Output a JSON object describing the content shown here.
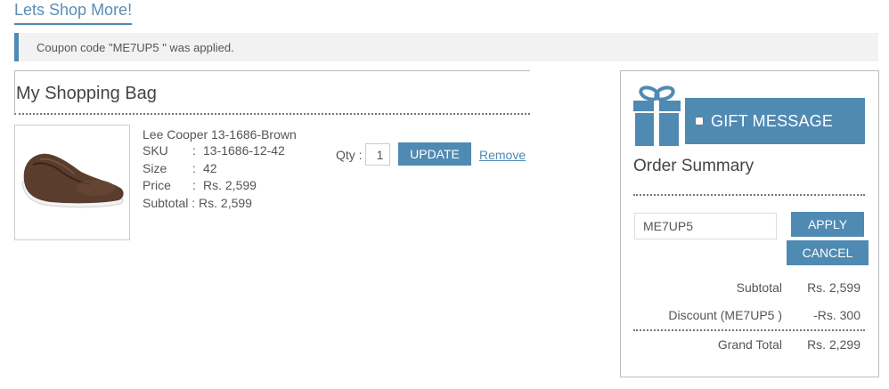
{
  "header": {
    "shop_more_link": "Lets Shop More!"
  },
  "notice": {
    "message": "Coupon code \"ME7UP5 \" was applied."
  },
  "bag": {
    "title": "My Shopping Bag",
    "item": {
      "name": "Lee Cooper 13-1686-Brown",
      "sku_label": "SKU",
      "sku_colon": ":",
      "sku_value": "13-1686-12-42",
      "size_label": "Size",
      "size_colon": ":",
      "size_value": "42",
      "price_label": "Price",
      "price_colon": ":",
      "price_value": "Rs. 2,599",
      "subtotal_text": "Subtotal : Rs. 2,599",
      "qty_label": "Qty :",
      "qty_value": "1",
      "update_label": "UPDATE",
      "remove_label": "Remove"
    }
  },
  "summary": {
    "gift_label": "GIFT MESSAGE",
    "title": "Order Summary",
    "coupon_value": "ME7UP5",
    "apply_label": "APPLY",
    "cancel_label": "CANCEL",
    "subtotal_label": "Subtotal",
    "subtotal_value": "Rs. 2,599",
    "discount_label": "Discount (ME7UP5 )",
    "discount_value": "-Rs. 300",
    "grand_total_label": "Grand Total",
    "grand_total_value": "Rs. 2,299"
  },
  "colors": {
    "accent": "#4f8ab3",
    "link": "#5b8db4",
    "notice_bg": "#f2f2f2"
  },
  "icons": {
    "gift": "gift-icon",
    "shoe": "shoe-image"
  }
}
